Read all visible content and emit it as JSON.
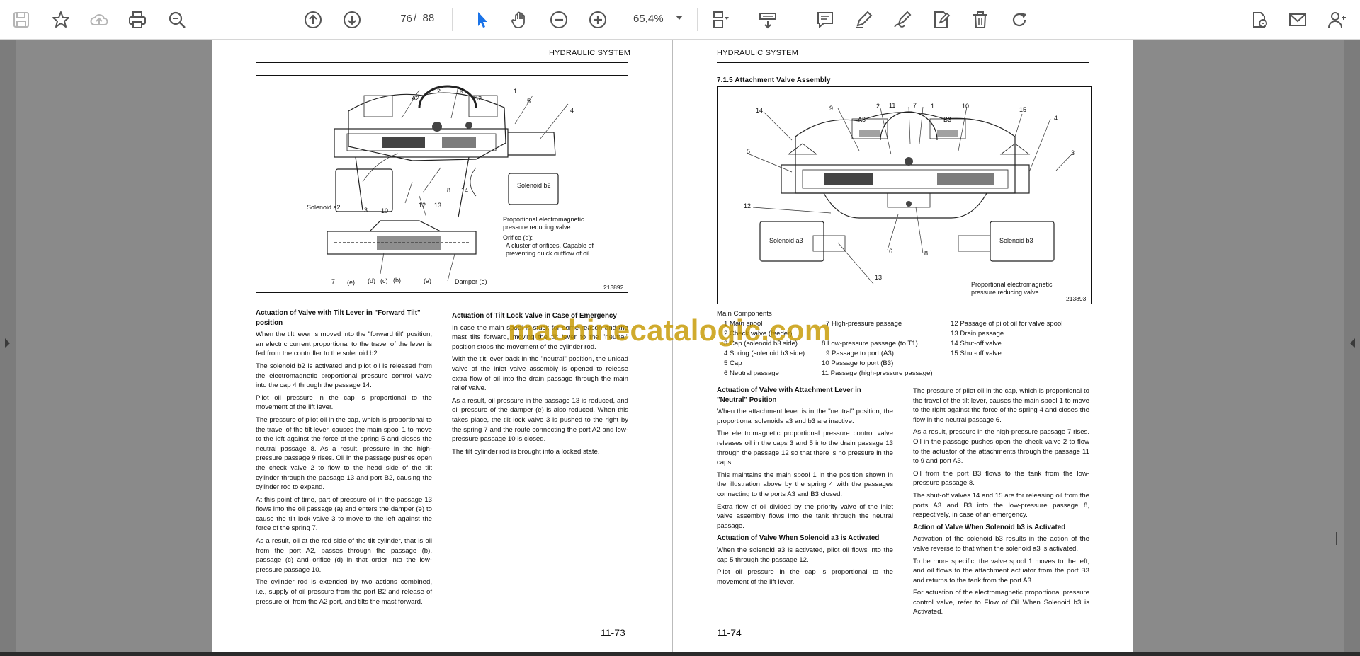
{
  "toolbar": {
    "left_icons": [
      "save-icon",
      "bookmark-star-icon",
      "cloud-upload-icon",
      "print-icon",
      "zoom-out-magnifier-icon"
    ],
    "nav_icons": [
      "page-up-icon",
      "page-down-icon"
    ],
    "current_page": "76",
    "separator": "/",
    "total_pages": "88",
    "zoom_out_label": "−",
    "zoom_in_label": "+",
    "zoom_value": "65,4%",
    "tools": [
      "select-pointer-icon",
      "hand-pan-icon",
      "zoom-out-icon",
      "zoom-in-icon",
      "fit-page-icon",
      "scroll-mode-icon"
    ],
    "annotate_icons": [
      "comment-icon",
      "highlight-pen-icon",
      "draw-sign-icon",
      "edit-doc-icon",
      "delete-icon",
      "rotate-icon"
    ],
    "right_icons": [
      "share-link-icon",
      "email-icon",
      "add-user-icon"
    ]
  },
  "left_page": {
    "header": "HYDRAULIC SYSTEM",
    "figure": {
      "labels": [
        "A2",
        "2",
        "9",
        "B2",
        "1",
        "5",
        "4",
        "8",
        "14",
        "Solenoid b2",
        "Solenoid a2",
        "3",
        "10",
        "12",
        "13",
        "7",
        "(e)",
        "(d)",
        "(c)",
        "(b)",
        "(a)",
        "Damper (e)"
      ],
      "note1": "Proportional electromagnetic",
      "note2": "pressure reducing valve",
      "note3": "Orifice (d):",
      "note4": "A cluster of orifices. Capable of",
      "note5": "preventing quick outflow of oil.",
      "number": "213892"
    },
    "col1": {
      "title": "Actuation of Valve with Tilt Lever in \"Forward Tilt\" position",
      "p1": "When the tilt lever is moved into the \"forward tilt\" position, an electric current proportional to the travel of the lever is fed from the controller to the solenoid b2.",
      "p2": "The solenoid b2 is activated and pilot oil is released from the electromagnetic proportional pressure control valve into the cap 4 through the passage 14.",
      "p3": "Pilot oil pressure in the cap is proportional to the movement of the lift lever.",
      "p4": "The pressure of pilot oil in the cap, which is proportional to the travel of the tilt lever, causes the main spool 1 to move to the left against the force of the spring 5 and closes the neutral passage 8. As a result, pressure in the high-pressure passage 9 rises. Oil in the passage pushes open the check valve 2 to flow to the head side of the tilt cylinder through the passage 13 and port B2, causing the cylinder rod to expand.",
      "p5": "At this point of time, part of pressure oil in the passage 13 flows into the oil passage (a) and enters the damper (e) to cause the tilt lock valve 3 to move to the left against the force of the spring 7.",
      "p6": "As a result, oil at the rod side of the tilt cylinder, that is oil from the port A2, passes through the passage (b), passage (c) and orifice (d) in that order into the low-pressure passage 10.",
      "p7": "The cylinder rod is extended by two actions combined, i.e., supply of oil pressure from the port B2 and release of pressure oil from the A2 port, and tilts the mast forward."
    },
    "col2": {
      "title": "Actuation of Tilt Lock Valve in Case of Emergency",
      "p1": "In case the main spool is stuck for some reason and the mast tilts forward, moving the tilt lever to the \"neutral\" position stops the movement of the cylinder rod.",
      "p2": "With the tilt lever back in the \"neutral\" position, the unload valve of the inlet valve assembly is opened to release extra flow of oil into the drain passage through the main relief valve.",
      "p3": "As a result, oil pressure in the passage 13 is reduced, and oil pressure of the damper (e) is also reduced. When this takes place, the tilt lock valve 3 is pushed to the right by the spring 7 and the route connecting the port A2 and low-pressure passage 10 is closed.",
      "p4": "The tilt cylinder rod is brought into a locked state."
    },
    "page_number": "11-73"
  },
  "right_page": {
    "header": "HYDRAULIC SYSTEM",
    "section": "7.1.5   Attachment Valve Assembly",
    "figure": {
      "labels": [
        "14",
        "9",
        "A3",
        "2",
        "11",
        "7",
        "1",
        "B3",
        "10",
        "15",
        "4",
        "5",
        "3",
        "12",
        "Solenoid a3",
        "6",
        "8",
        "Solenoid b3",
        "13"
      ],
      "note1": "Proportional electromagnetic",
      "note2": "pressure reducing valve",
      "number": "213893"
    },
    "components_title": "Main Components",
    "components": [
      "1  Main spool",
      "2  Check valve (feeder)",
      "3  Cap (solenoid b3 side)",
      "4  Spring (solenoid b3 side)",
      "5  Cap",
      "6  Neutral passage",
      "7  High-pressure passage",
      "8  Low-pressure passage (to T1)",
      "9  Passage to port (A3)",
      "10  Passage to port (B3)",
      "11  Passage (high-pressure passage)",
      "12  Passage of pilot oil for valve spool",
      "13  Drain passage",
      "14  Shut-off valve",
      "15  Shut-off valve"
    ],
    "col1": {
      "title": "Actuation of Valve with Attachment Lever in \"Neutral\" Position",
      "p1": "When the attachment lever is in the \"neutral\" position, the proportional solenoids a3 and b3 are inactive.",
      "p2": "The electromagnetic proportional pressure control valve releases oil in the caps 3 and 5 into the drain passage 13 through the passage 12 so that there is no pressure in the caps.",
      "p3": "This maintains the main spool 1 in the position shown in the illustration above by the spring 4 with the passages connecting to the ports A3 and B3 closed.",
      "p4": "Extra flow of oil divided by the priority valve of the inlet valve assembly flows into the tank through the neutral passage.",
      "title2": "Actuation of Valve When Solenoid a3 is Activated",
      "p5": "When the solenoid a3 is activated, pilot oil flows into the cap 5 through the passage 12.",
      "p6": "Pilot oil pressure in the cap is proportional to the movement of the lift lever."
    },
    "col2": {
      "p1": "The pressure of pilot oil in the cap, which is proportional to the travel of the tilt lever, causes the main spool 1 to move to the right against the force of the spring 4 and closes the flow in the neutral passage 6.",
      "p2": "As a result, pressure in the high-pressure passage 7 rises. Oil in the passage pushes open the check valve 2 to flow to the actuator of the attachments through the passage 11 to 9 and port A3.",
      "p3": "Oil from the port B3 flows to the tank from the low-pressure passage 8.",
      "p4": "The shut-off valves 14 and 15 are for releasing oil from the ports A3 and B3 into the low-pressure passage 8, respectively, in case of an emergency.",
      "title": "Action of Valve When Solenoid b3 is Activated",
      "p5": "Activation of the solenoid b3 results in the action of the valve reverse to that when the solenoid a3 is activated.",
      "p6": "To be more specific, the valve spool 1 moves to the left, and oil flows to the attachment actuator from the port B3 and returns to the tank from the port A3.",
      "p7": "For actuation of the electromagnetic proportional pressure control valve, refer to Flow of Oil When Solenoid b3 is Activated."
    },
    "page_number": "11-74"
  },
  "watermark": "machinecatalogic.com",
  "colors": {
    "accent_blue": "#1a73e8",
    "icon_gray": "#555555",
    "watermark": "#c69800",
    "viewer_bg": "#8a8a8a"
  }
}
